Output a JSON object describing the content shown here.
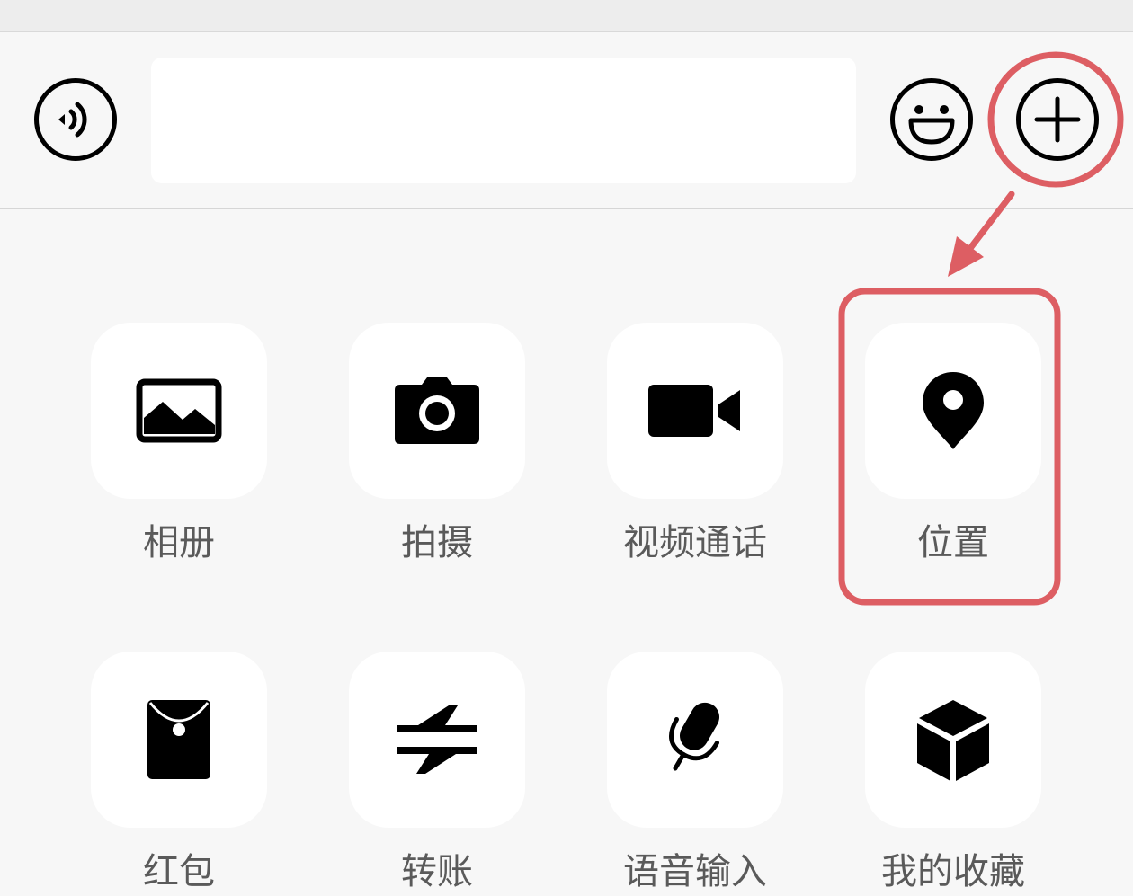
{
  "input_bar": {
    "voice_icon": "voice-wave-icon",
    "message_value": "",
    "emoji_icon": "smiley-icon",
    "plus_icon": "plus-circle-icon"
  },
  "more_panel": {
    "items": [
      {
        "label": "相册",
        "icon": "photo-album-icon"
      },
      {
        "label": "拍摄",
        "icon": "camera-icon"
      },
      {
        "label": "视频通话",
        "icon": "video-call-icon"
      },
      {
        "label": "位置",
        "icon": "location-pin-icon"
      },
      {
        "label": "红包",
        "icon": "red-packet-icon"
      },
      {
        "label": "转账",
        "icon": "transfer-icon"
      },
      {
        "label": "语音输入",
        "icon": "voice-input-icon"
      },
      {
        "label": "我的收藏",
        "icon": "favorites-icon"
      }
    ]
  },
  "annotation": {
    "color": "#dd5e63",
    "highlighted_button": "plus-button",
    "highlighted_item": "位置"
  },
  "colors": {
    "panel_background": "#f7f7f7",
    "tile_background": "#ffffff",
    "icon": "#000000",
    "label_text": "#5a5a5a"
  }
}
